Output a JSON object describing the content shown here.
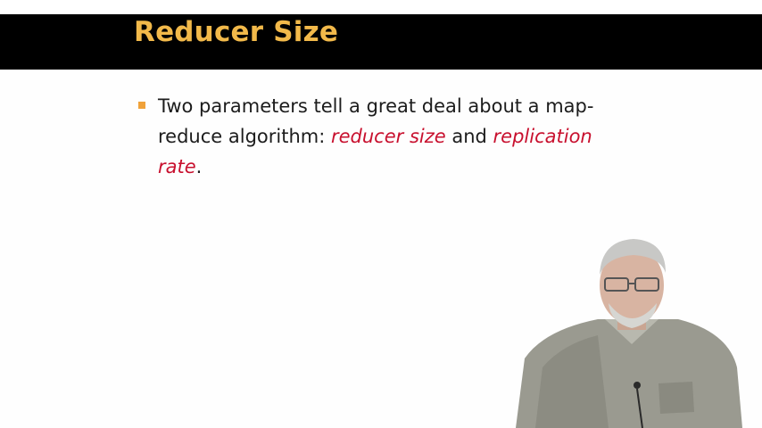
{
  "slide": {
    "title": "Reducer Size",
    "bullet": {
      "line1": "Two parameters tell a great deal about a map-",
      "line2_prefix": "reduce algorithm: ",
      "term1": "reducer size",
      "connector": " and ",
      "term2_part1": "replication",
      "term2_part2": "rate",
      "period": "."
    }
  },
  "colors": {
    "title_bar": "#000000",
    "title_text": "#f2b94a",
    "bullet_marker": "#f0a23a",
    "body_text": "#1c1c1c",
    "emphasis": "#c8102e",
    "background": "#fefefe"
  }
}
